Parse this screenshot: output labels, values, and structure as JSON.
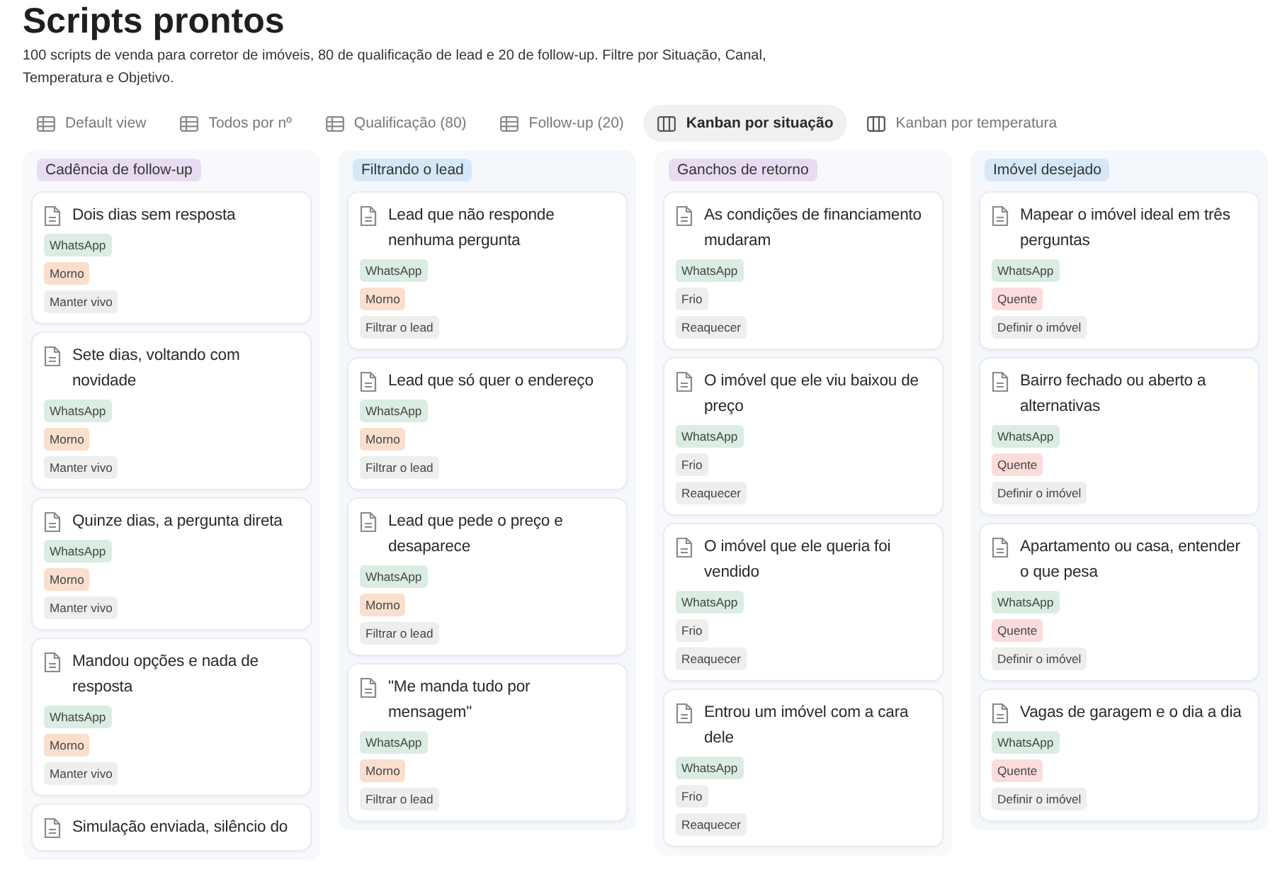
{
  "page": {
    "title": "Scripts prontos",
    "description": "100 scripts de venda para corretor de imóveis, 80 de qualificação de lead e 20 de follow-up. Filtre por Situação, Canal, Temperatura e Objetivo."
  },
  "tabs": [
    {
      "label": "Default view",
      "kind": "table",
      "selected": false
    },
    {
      "label": "Todos por nº",
      "kind": "table",
      "selected": false
    },
    {
      "label": "Qualificação (80)",
      "kind": "table",
      "selected": false
    },
    {
      "label": "Follow-up (20)",
      "kind": "table",
      "selected": false
    },
    {
      "label": "Kanban por situação",
      "kind": "board",
      "selected": true
    },
    {
      "label": "Kanban por temperatura",
      "kind": "board",
      "selected": false
    }
  ],
  "columns": [
    {
      "title": "Cadência de follow-up",
      "color": "#e8dcf2",
      "cards": [
        {
          "title": "Dois dias sem resposta",
          "tags": [
            {
              "label": "WhatsApp",
              "color": "#dbede2"
            },
            {
              "label": "Morno",
              "color": "#f9dfcc"
            },
            {
              "label": "Manter vivo",
              "color": "#eeeeed"
            }
          ]
        },
        {
          "title": "Sete dias, voltando com novidade",
          "tags": [
            {
              "label": "WhatsApp",
              "color": "#dbede2"
            },
            {
              "label": "Morno",
              "color": "#f9dfcc"
            },
            {
              "label": "Manter vivo",
              "color": "#eeeeed"
            }
          ]
        },
        {
          "title": "Quinze dias, a pergunta direta",
          "tags": [
            {
              "label": "WhatsApp",
              "color": "#dbede2"
            },
            {
              "label": "Morno",
              "color": "#f9dfcc"
            },
            {
              "label": "Manter vivo",
              "color": "#eeeeed"
            }
          ]
        },
        {
          "title": "Mandou opções e nada de resposta",
          "tags": [
            {
              "label": "WhatsApp",
              "color": "#dbede2"
            },
            {
              "label": "Morno",
              "color": "#f9dfcc"
            },
            {
              "label": "Manter vivo",
              "color": "#eeeeed"
            }
          ]
        },
        {
          "title": "Simulação enviada, silêncio do"
        }
      ]
    },
    {
      "title": "Filtrando o lead",
      "color": "#d6e8f7",
      "cards": [
        {
          "title": "Lead que não responde nenhuma pergunta",
          "tags": [
            {
              "label": "WhatsApp",
              "color": "#dbede2"
            },
            {
              "label": "Morno",
              "color": "#f9dfcc"
            },
            {
              "label": "Filtrar o lead",
              "color": "#eeeeed"
            }
          ]
        },
        {
          "title": "Lead que só quer o endereço",
          "tags": [
            {
              "label": "WhatsApp",
              "color": "#dbede2"
            },
            {
              "label": "Morno",
              "color": "#f9dfcc"
            },
            {
              "label": "Filtrar o lead",
              "color": "#eeeeed"
            }
          ]
        },
        {
          "title": "Lead que pede o preço e desaparece",
          "tags": [
            {
              "label": "WhatsApp",
              "color": "#dbede2"
            },
            {
              "label": "Morno",
              "color": "#f9dfcc"
            },
            {
              "label": "Filtrar o lead",
              "color": "#eeeeed"
            }
          ]
        },
        {
          "title": "\"Me manda tudo por mensagem\"",
          "tags": [
            {
              "label": "WhatsApp",
              "color": "#dbede2"
            },
            {
              "label": "Morno",
              "color": "#f9dfcc"
            },
            {
              "label": "Filtrar o lead",
              "color": "#eeeeed"
            }
          ]
        }
      ]
    },
    {
      "title": "Ganchos de retorno",
      "color": "#e8dcf2",
      "cards": [
        {
          "title": "As condições de financiamento mudaram",
          "tags": [
            {
              "label": "WhatsApp",
              "color": "#dbede2"
            },
            {
              "label": "Frio",
              "color": "#eeeeed"
            },
            {
              "label": "Reaquecer",
              "color": "#eeeeed"
            }
          ]
        },
        {
          "title": "O imóvel que ele viu baixou de preço",
          "tags": [
            {
              "label": "WhatsApp",
              "color": "#dbede2"
            },
            {
              "label": "Frio",
              "color": "#eeeeed"
            },
            {
              "label": "Reaquecer",
              "color": "#eeeeed"
            }
          ]
        },
        {
          "title": "O imóvel que ele queria foi vendido",
          "tags": [
            {
              "label": "WhatsApp",
              "color": "#dbede2"
            },
            {
              "label": "Frio",
              "color": "#eeeeed"
            },
            {
              "label": "Reaquecer",
              "color": "#eeeeed"
            }
          ]
        },
        {
          "title": "Entrou um imóvel com a cara dele",
          "tags": [
            {
              "label": "WhatsApp",
              "color": "#dbede2"
            },
            {
              "label": "Frio",
              "color": "#eeeeed"
            },
            {
              "label": "Reaquecer",
              "color": "#eeeeed"
            }
          ]
        }
      ]
    },
    {
      "title": "Imóvel desejado",
      "color": "#d6e8f7",
      "cards": [
        {
          "title": "Mapear o imóvel ideal em três perguntas",
          "tags": [
            {
              "label": "WhatsApp",
              "color": "#dbede2"
            },
            {
              "label": "Quente",
              "color": "#fbdcda"
            },
            {
              "label": "Definir o imóvel",
              "color": "#eeeeed"
            }
          ]
        },
        {
          "title": "Bairro fechado ou aberto a alternativas",
          "tags": [
            {
              "label": "WhatsApp",
              "color": "#dbede2"
            },
            {
              "label": "Quente",
              "color": "#fbdcda"
            },
            {
              "label": "Definir o imóvel",
              "color": "#eeeeed"
            }
          ]
        },
        {
          "title": "Apartamento ou casa, entender o que pesa",
          "tags": [
            {
              "label": "WhatsApp",
              "color": "#dbede2"
            },
            {
              "label": "Quente",
              "color": "#fbdcda"
            },
            {
              "label": "Definir o imóvel",
              "color": "#eeeeed"
            }
          ]
        },
        {
          "title": "Vagas de garagem e o dia a dia",
          "tags": [
            {
              "label": "WhatsApp",
              "color": "#dbede2"
            },
            {
              "label": "Quente",
              "color": "#fbdcda"
            },
            {
              "label": "Definir o imóvel",
              "color": "#eeeeed"
            }
          ]
        }
      ]
    }
  ]
}
